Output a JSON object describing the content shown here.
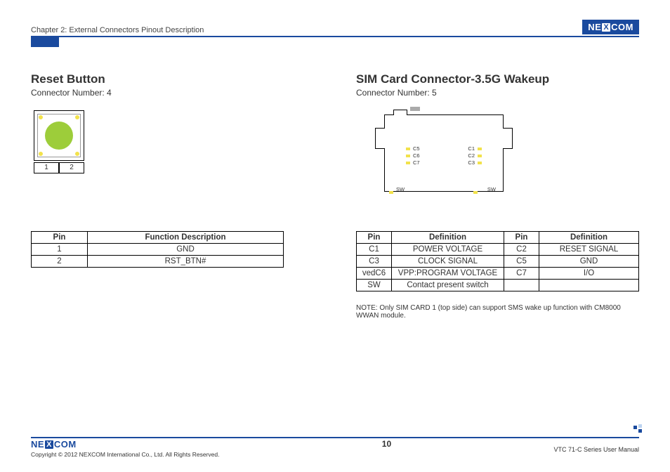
{
  "header": {
    "chapter": "Chapter 2: External Connectors Pinout Description",
    "brand": "NEXCOM"
  },
  "left": {
    "title": "Reset Button",
    "subtitle": "Connector Number: 4",
    "pin_labels": {
      "p1": "1",
      "p2": "2"
    },
    "table": {
      "headers": {
        "pin": "Pin",
        "func": "Function Description"
      },
      "rows": [
        {
          "pin": "1",
          "func": "GND"
        },
        {
          "pin": "2",
          "func": "RST_BTN#"
        }
      ]
    }
  },
  "right": {
    "title": "SIM Card Connector-3.5G Wakeup",
    "subtitle": "Connector Number: 5",
    "diagram_labels": {
      "c5": "C5",
      "c6": "C6",
      "c7": "C7",
      "c1": "C1",
      "c2": "C2",
      "c3": "C3",
      "sw_left": "SW",
      "sw_right": "SW"
    },
    "table": {
      "headers": {
        "pin": "Pin",
        "def": "Definition"
      },
      "rows": [
        {
          "p1": "C1",
          "d1": "POWER VOLTAGE",
          "p2": "C2",
          "d2": "RESET SIGNAL"
        },
        {
          "p1": "C3",
          "d1": "CLOCK SIGNAL",
          "p2": "C5",
          "d2": "GND"
        },
        {
          "p1": "vedC6",
          "d1": "VPP:PROGRAM VOLTAGE",
          "p2": "C7",
          "d2": "I/O"
        },
        {
          "p1": "SW",
          "d1": "Contact present switch",
          "p2": "",
          "d2": ""
        }
      ]
    },
    "note": "NOTE: Only SIM CARD 1 (top side) can support SMS wake up function with CM8000 WWAN module."
  },
  "footer": {
    "brand": "NEXCOM",
    "copyright": "Copyright © 2012 NEXCOM International Co., Ltd. All Rights Reserved.",
    "page": "10",
    "manual": "VTC 71-C Series User Manual"
  }
}
